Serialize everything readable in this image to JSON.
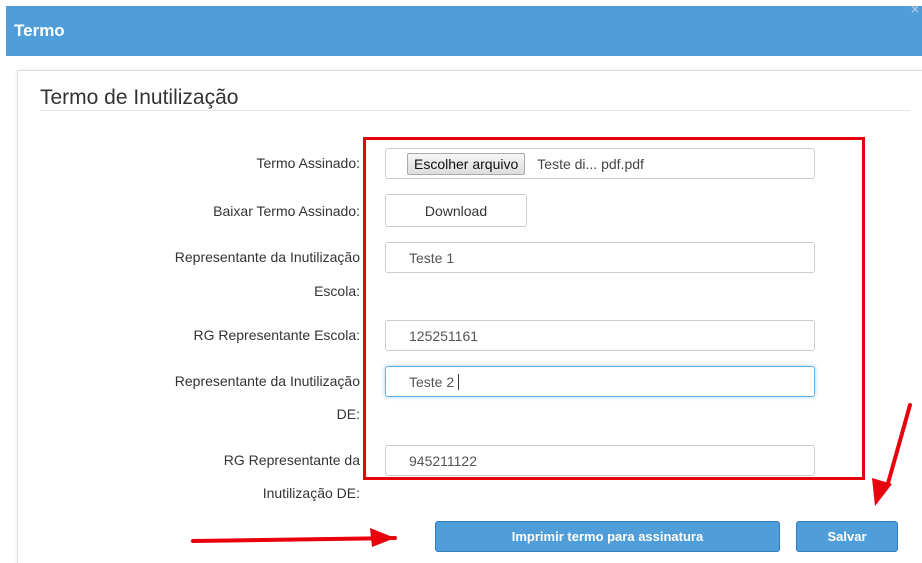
{
  "window": {
    "title": "Termo",
    "close_glyph": "×"
  },
  "section": {
    "title": "Termo de Inutilização"
  },
  "form": {
    "termo_assinado": {
      "label": "Termo Assinado:",
      "button_label": "Escolher arquivo",
      "file_name": "Teste di... pdf.pdf"
    },
    "baixar_termo": {
      "label": "Baixar Termo Assinado:",
      "button_label": "Download"
    },
    "representante_escola": {
      "label_line1": "Representante da Inutilização",
      "label_line2": "Escola:",
      "value": "Teste 1"
    },
    "rg_escola": {
      "label": "RG Representante Escola:",
      "value": "125251161"
    },
    "representante_de": {
      "label_line1": "Representante da Inutilização",
      "label_line2": "DE:",
      "value": "Teste 2"
    },
    "rg_de": {
      "label_line1": "RG Representante da",
      "label_line2": "Inutilização DE:",
      "value": "945211122"
    }
  },
  "actions": {
    "print_label": "Imprimir termo para assinatura",
    "save_label": "Salvar"
  },
  "colors": {
    "header_blue": "#4f9ed9",
    "annotation_red": "#e8000d",
    "focus_blue": "#66afe9"
  },
  "icons": {
    "close": "close-icon",
    "annotation_arrows": "red-arrow-icon"
  }
}
